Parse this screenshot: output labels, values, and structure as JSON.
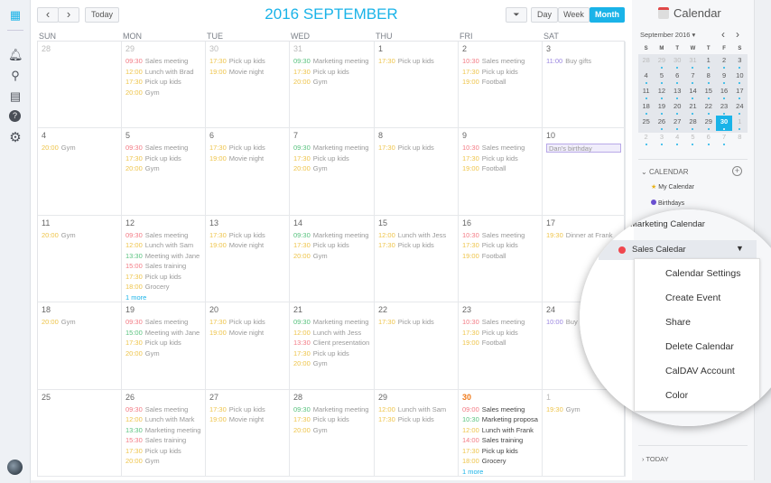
{
  "nav": {
    "icons": [
      "dashboard-icon",
      "bell-icon",
      "search-icon",
      "calendar-check-icon",
      "help-icon",
      "gear-icon"
    ]
  },
  "toolbar": {
    "prev": "‹",
    "next": "›",
    "today": "Today",
    "filter": "⏷",
    "views": [
      "Day",
      "Week",
      "Month"
    ],
    "active_view": "Month"
  },
  "title": "2016 SEPTEMBER",
  "weekdays": [
    "SUN",
    "MON",
    "TUE",
    "WED",
    "THU",
    "FRI",
    "SAT"
  ],
  "colors": {
    "red": "#f37a84",
    "yellow": "#eec44a",
    "green": "#58c27e",
    "purple": "#9a86e0",
    "accent": "#1ab3e8"
  },
  "weeks": [
    [
      {
        "d": "28",
        "muted": true,
        "ev": []
      },
      {
        "d": "29",
        "muted": true,
        "ev": [
          [
            "09:30",
            "Sales meeting",
            "red"
          ],
          [
            "12:00",
            "Lunch with Brad",
            "yellow"
          ],
          [
            "17:30",
            "Pick up kids",
            "yellow"
          ],
          [
            "20:00",
            "Gym",
            "yellow"
          ]
        ]
      },
      {
        "d": "30",
        "muted": true,
        "ev": [
          [
            "17:30",
            "Pick up kids",
            "yellow"
          ],
          [
            "19:00",
            "Movie night",
            "yellow"
          ]
        ]
      },
      {
        "d": "31",
        "muted": true,
        "ev": [
          [
            "09:30",
            "Marketing meeting",
            "green"
          ],
          [
            "17:30",
            "Pick up kids",
            "yellow"
          ],
          [
            "20:00",
            "Gym",
            "yellow"
          ]
        ]
      },
      {
        "d": "1",
        "ev": [
          [
            "17:30",
            "Pick up kids",
            "yellow"
          ]
        ]
      },
      {
        "d": "2",
        "ev": [
          [
            "10:30",
            "Sales meeting",
            "red"
          ],
          [
            "17:30",
            "Pick up kids",
            "yellow"
          ],
          [
            "19:00",
            "Football",
            "yellow"
          ]
        ]
      },
      {
        "d": "3",
        "ev": [
          [
            "11:00",
            "Buy gifts",
            "purple"
          ]
        ]
      }
    ],
    [
      {
        "d": "4",
        "ev": [
          [
            "20:00",
            "Gym",
            "yellow"
          ]
        ]
      },
      {
        "d": "5",
        "ev": [
          [
            "09:30",
            "Sales meeting",
            "red"
          ],
          [
            "17:30",
            "Pick up kids",
            "yellow"
          ],
          [
            "20:00",
            "Gym",
            "yellow"
          ]
        ]
      },
      {
        "d": "6",
        "ev": [
          [
            "17:30",
            "Pick up kids",
            "yellow"
          ],
          [
            "19:00",
            "Movie night",
            "yellow"
          ]
        ]
      },
      {
        "d": "7",
        "ev": [
          [
            "09:30",
            "Marketing meeting",
            "green"
          ],
          [
            "17:30",
            "Pick up kids",
            "yellow"
          ],
          [
            "20:00",
            "Gym",
            "yellow"
          ]
        ]
      },
      {
        "d": "8",
        "ev": [
          [
            "17:30",
            "Pick up kids",
            "yellow"
          ]
        ]
      },
      {
        "d": "9",
        "ev": [
          [
            "10:30",
            "Sales meeting",
            "red"
          ],
          [
            "17:30",
            "Pick up kids",
            "yellow"
          ],
          [
            "19:00",
            "Football",
            "yellow"
          ]
        ]
      },
      {
        "d": "10",
        "allday": "Dan's birthday",
        "ev": []
      }
    ],
    [
      {
        "d": "11",
        "ev": [
          [
            "20:00",
            "Gym",
            "yellow"
          ]
        ]
      },
      {
        "d": "12",
        "ev": [
          [
            "09:30",
            "Sales meeting",
            "red"
          ],
          [
            "12:00",
            "Lunch with Sam",
            "yellow"
          ],
          [
            "13:30",
            "Meeting with Jane",
            "green"
          ],
          [
            "15:00",
            "Sales training",
            "red"
          ],
          [
            "17:30",
            "Pick up kids",
            "yellow"
          ],
          [
            "18:00",
            "Grocery",
            "yellow"
          ]
        ],
        "more": "1 more"
      },
      {
        "d": "13",
        "ev": [
          [
            "17:30",
            "Pick up kids",
            "yellow"
          ],
          [
            "19:00",
            "Movie night",
            "yellow"
          ]
        ]
      },
      {
        "d": "14",
        "ev": [
          [
            "09:30",
            "Marketing meeting",
            "green"
          ],
          [
            "17:30",
            "Pick up kids",
            "yellow"
          ],
          [
            "20:00",
            "Gym",
            "yellow"
          ]
        ]
      },
      {
        "d": "15",
        "ev": [
          [
            "12:00",
            "Lunch with Jess",
            "yellow"
          ],
          [
            "17:30",
            "Pick up kids",
            "yellow"
          ]
        ]
      },
      {
        "d": "16",
        "ev": [
          [
            "10:30",
            "Sales meeting",
            "red"
          ],
          [
            "17:30",
            "Pick up kids",
            "yellow"
          ],
          [
            "19:00",
            "Football",
            "yellow"
          ]
        ]
      },
      {
        "d": "17",
        "ev": [
          [
            "19:30",
            "Dinner at Frank",
            "yellow"
          ]
        ]
      }
    ],
    [
      {
        "d": "18",
        "ev": [
          [
            "20:00",
            "Gym",
            "yellow"
          ]
        ]
      },
      {
        "d": "19",
        "ev": [
          [
            "09:30",
            "Sales meeting",
            "red"
          ],
          [
            "15:00",
            "Meeting with Jane",
            "green"
          ],
          [
            "17:30",
            "Pick up kids",
            "yellow"
          ],
          [
            "20:00",
            "Gym",
            "yellow"
          ]
        ]
      },
      {
        "d": "20",
        "ev": [
          [
            "17:30",
            "Pick up kids",
            "yellow"
          ],
          [
            "19:00",
            "Movie night",
            "yellow"
          ]
        ]
      },
      {
        "d": "21",
        "ev": [
          [
            "09:30",
            "Marketing meeting",
            "green"
          ],
          [
            "12:00",
            "Lunch with Jess",
            "yellow"
          ],
          [
            "13:30",
            "Client presentation",
            "red"
          ],
          [
            "17:30",
            "Pick up kids",
            "yellow"
          ],
          [
            "20:00",
            "Gym",
            "yellow"
          ]
        ]
      },
      {
        "d": "22",
        "ev": [
          [
            "17:30",
            "Pick up kids",
            "yellow"
          ]
        ]
      },
      {
        "d": "23",
        "ev": [
          [
            "10:30",
            "Sales meeting",
            "red"
          ],
          [
            "17:30",
            "Pick up kids",
            "yellow"
          ],
          [
            "19:00",
            "Football",
            "yellow"
          ]
        ]
      },
      {
        "d": "24",
        "ev": [
          [
            "10:00",
            "Buy gifts",
            "purple"
          ]
        ]
      }
    ],
    [
      {
        "d": "25",
        "ev": []
      },
      {
        "d": "26",
        "ev": [
          [
            "09:30",
            "Sales meeting",
            "red"
          ],
          [
            "12:00",
            "Lunch with Mark",
            "yellow"
          ],
          [
            "13:30",
            "Marketing meeting",
            "green"
          ],
          [
            "15:30",
            "Sales training",
            "red"
          ],
          [
            "17:30",
            "Pick up kids",
            "yellow"
          ],
          [
            "20:00",
            "Gym",
            "yellow"
          ]
        ]
      },
      {
        "d": "27",
        "ev": [
          [
            "17:30",
            "Pick up kids",
            "yellow"
          ],
          [
            "19:00",
            "Movie night",
            "yellow"
          ]
        ]
      },
      {
        "d": "28",
        "ev": [
          [
            "09:30",
            "Marketing meeting",
            "green"
          ],
          [
            "17:30",
            "Pick up kids",
            "yellow"
          ],
          [
            "20:00",
            "Gym",
            "yellow"
          ]
        ]
      },
      {
        "d": "29",
        "ev": [
          [
            "12:00",
            "Lunch with Sam",
            "yellow"
          ],
          [
            "17:30",
            "Pick up kids",
            "yellow"
          ]
        ]
      },
      {
        "d": "30",
        "today": true,
        "ev": [
          [
            "09:00",
            "Sales meeting",
            "red"
          ],
          [
            "10:30",
            "Marketing proposal",
            "green"
          ],
          [
            "12:00",
            "Lunch with Frank",
            "yellow"
          ],
          [
            "14:00",
            "Sales training",
            "red"
          ],
          [
            "17:30",
            "Pick up kids",
            "yellow"
          ],
          [
            "18:00",
            "Grocery",
            "yellow"
          ]
        ],
        "more": "1 more"
      },
      {
        "d": "1",
        "muted": true,
        "ev": [
          [
            "19:30",
            "Gym",
            "yellow"
          ]
        ]
      }
    ]
  ],
  "sidebar": {
    "title": "Calendar",
    "month": "September 2016 ▾",
    "prev": "‹",
    "next": "›",
    "mini_weekdays": [
      "S",
      "M",
      "T",
      "W",
      "T",
      "F",
      "S"
    ],
    "mini_weeks": [
      [
        "28",
        "29",
        "30",
        "31",
        "1",
        "2",
        "3"
      ],
      [
        "4",
        "5",
        "6",
        "7",
        "8",
        "9",
        "10"
      ],
      [
        "11",
        "12",
        "13",
        "14",
        "15",
        "16",
        "17"
      ],
      [
        "18",
        "19",
        "20",
        "21",
        "22",
        "23",
        "24"
      ],
      [
        "25",
        "26",
        "27",
        "28",
        "29",
        "30",
        "1"
      ],
      [
        "2",
        "3",
        "4",
        "5",
        "6",
        "7",
        "8"
      ]
    ],
    "selected": "30",
    "section": "CALENDAR",
    "add": "+",
    "calendars": [
      {
        "name": "My Calendar",
        "icon": "star-icon",
        "color": "#e8b21a"
      },
      {
        "name": "Birthdays",
        "icon": "dot",
        "color": "#6a4fd0"
      }
    ],
    "today_section": "TODAY"
  },
  "magnified": {
    "calendars": [
      {
        "name": "Marketing Calendar",
        "color": "#1aa53a"
      },
      {
        "name": "Sales Caledar",
        "color": "#f0474e"
      }
    ],
    "menu": [
      "Calendar Settings",
      "Create Event",
      "Share",
      "Delete Calendar",
      "CalDAV Account",
      "Color"
    ]
  }
}
